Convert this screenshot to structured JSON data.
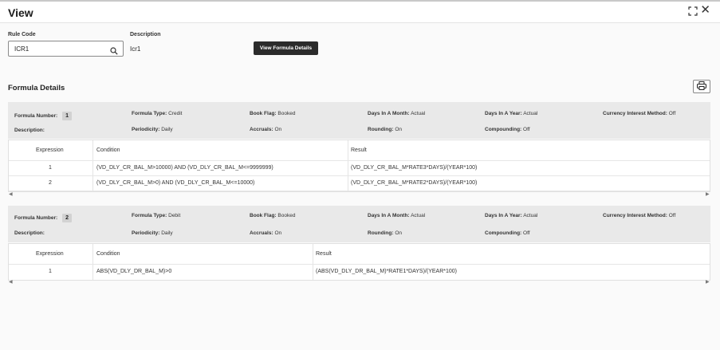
{
  "header": {
    "title": "View",
    "expand_icon": "expand-icon",
    "close_icon": "close-icon"
  },
  "form": {
    "rule_code_label": "Rule Code",
    "rule_code_value": "ICR1",
    "description_label": "Description",
    "description_value": "Icr1",
    "view_formula_button": "View Formula Details"
  },
  "section": {
    "title": "Formula Details",
    "print_icon": "printer-icon"
  },
  "formulas": [
    {
      "number_label": "Formula Number:",
      "number": "1",
      "type_label": "Formula Type:",
      "type": "Credit",
      "book_flag_label": "Book Flag:",
      "book_flag": "Booked",
      "days_month_label": "Days In A Month:",
      "days_month": "Actual",
      "days_year_label": "Days In A Year:",
      "days_year": "Actual",
      "currency_label": "Currency Interest Method:",
      "currency": "Off",
      "description_label": "Description:",
      "description": "",
      "periodicity_label": "Periodicity:",
      "periodicity": "Daily",
      "accruals_label": "Accruals:",
      "accruals": "On",
      "rounding_label": "Rounding:",
      "rounding": "On",
      "compounding_label": "Compounding:",
      "compounding": "Off",
      "columns": [
        "Expression",
        "Condition",
        "Result"
      ],
      "rows": [
        {
          "expression": "1",
          "condition": "(VD_DLY_CR_BAL_M>10000) AND (VD_DLY_CR_BAL_M<=9999999)",
          "result": "(VD_DLY_CR_BAL_M*RATE3*DAYS)/(YEAR*100)"
        },
        {
          "expression": "2",
          "condition": "(VD_DLY_CR_BAL_M>0) AND (VD_DLY_CR_BAL_M<=10000)",
          "result": "(VD_DLY_CR_BAL_M*RATE2*DAYS)/(YEAR*100)"
        }
      ]
    },
    {
      "number_label": "Formula Number:",
      "number": "2",
      "type_label": "Formula Type:",
      "type": "Debit",
      "book_flag_label": "Book Flag:",
      "book_flag": "Booked",
      "days_month_label": "Days In A Month:",
      "days_month": "Actual",
      "days_year_label": "Days In A Year:",
      "days_year": "Actual",
      "currency_label": "Currency Interest Method:",
      "currency": "Off",
      "description_label": "Description:",
      "description": "",
      "periodicity_label": "Periodicity:",
      "periodicity": "Daily",
      "accruals_label": "Accruals:",
      "accruals": "On",
      "rounding_label": "Rounding:",
      "rounding": "On",
      "compounding_label": "Compounding:",
      "compounding": "Off",
      "columns": [
        "Expression",
        "Condition",
        "Result"
      ],
      "rows": [
        {
          "expression": "1",
          "condition": "ABS(VD_DLY_DR_BAL_M)>0",
          "result": "(ABS(VD_DLY_DR_BAL_M)*RATE1*DAYS)/(YEAR*100)"
        }
      ]
    }
  ]
}
